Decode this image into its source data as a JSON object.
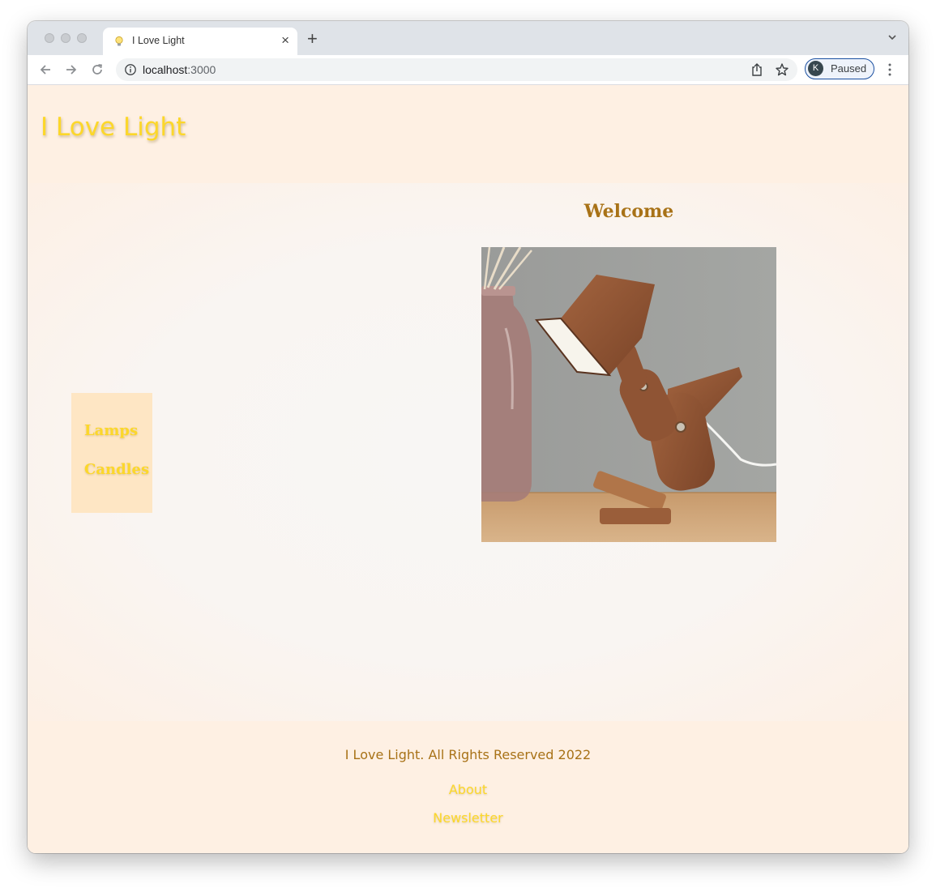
{
  "browser": {
    "tab_title": "I Love Light",
    "url_host": "localhost",
    "url_port": ":3000",
    "profile_initial": "K",
    "profile_status": "Paused",
    "icons": [
      "lightbulb-favicon-icon",
      "close-icon",
      "plus-icon",
      "chevron-down-icon",
      "back-arrow-icon",
      "forward-arrow-icon",
      "reload-icon",
      "info-icon",
      "share-icon",
      "star-icon",
      "more-vertical-icon"
    ]
  },
  "site": {
    "title": "I Love Light",
    "nav": [
      {
        "label": "Lamps"
      },
      {
        "label": "Candles"
      }
    ],
    "welcome_heading": "Welcome",
    "hero_image": "wooden-dinosaur-lamp-photo",
    "footer": {
      "copyright": "I Love Light. All Rights Reserved 2022",
      "links": [
        {
          "label": "About"
        },
        {
          "label": "Newsletter"
        }
      ]
    }
  },
  "colors": {
    "page_bg": "#fef0e3",
    "title_yellow": "#fcd72a",
    "heading_brown": "#a87217",
    "nav_bg": "#fee6c4"
  }
}
